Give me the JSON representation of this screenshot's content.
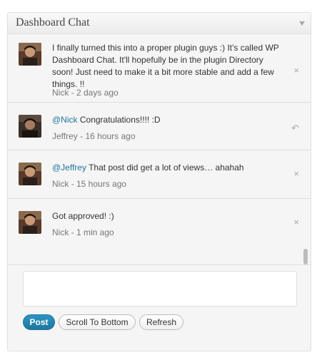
{
  "widget": {
    "title": "Dashboard Chat"
  },
  "messages": [
    {
      "mention": "",
      "text": "I finally turned this into a proper plugin guys :) It's called WP Dashboard Chat. It'll hopefully be in the plugin Directory soon! Just need to make it a bit more stable and add a few things. !!",
      "meta": "Nick - 2 days ago",
      "action": "×",
      "action_icon": "delete-icon"
    },
    {
      "mention": "@Nick",
      "text": " Congratulations!!!! :D",
      "meta": "Jeffrey - 16 hours ago",
      "action": "↶",
      "action_icon": "reply-icon"
    },
    {
      "mention": "@Jeffrey",
      "text": " That post did get a lot of views… ahahah",
      "meta": "Nick - 15 hours ago",
      "action": "×",
      "action_icon": "delete-icon"
    },
    {
      "mention": "",
      "text": "Got approved! :)",
      "meta": "Nick - 1 min ago",
      "action": "×",
      "action_icon": "delete-icon"
    }
  ],
  "composer": {
    "value": "",
    "placeholder": ""
  },
  "buttons": {
    "post": "Post",
    "scroll_to_bottom": "Scroll To Bottom",
    "refresh": "Refresh"
  },
  "colors": {
    "link": "#21759b",
    "primary_button": "#21759b",
    "meta_text": "#777777"
  }
}
